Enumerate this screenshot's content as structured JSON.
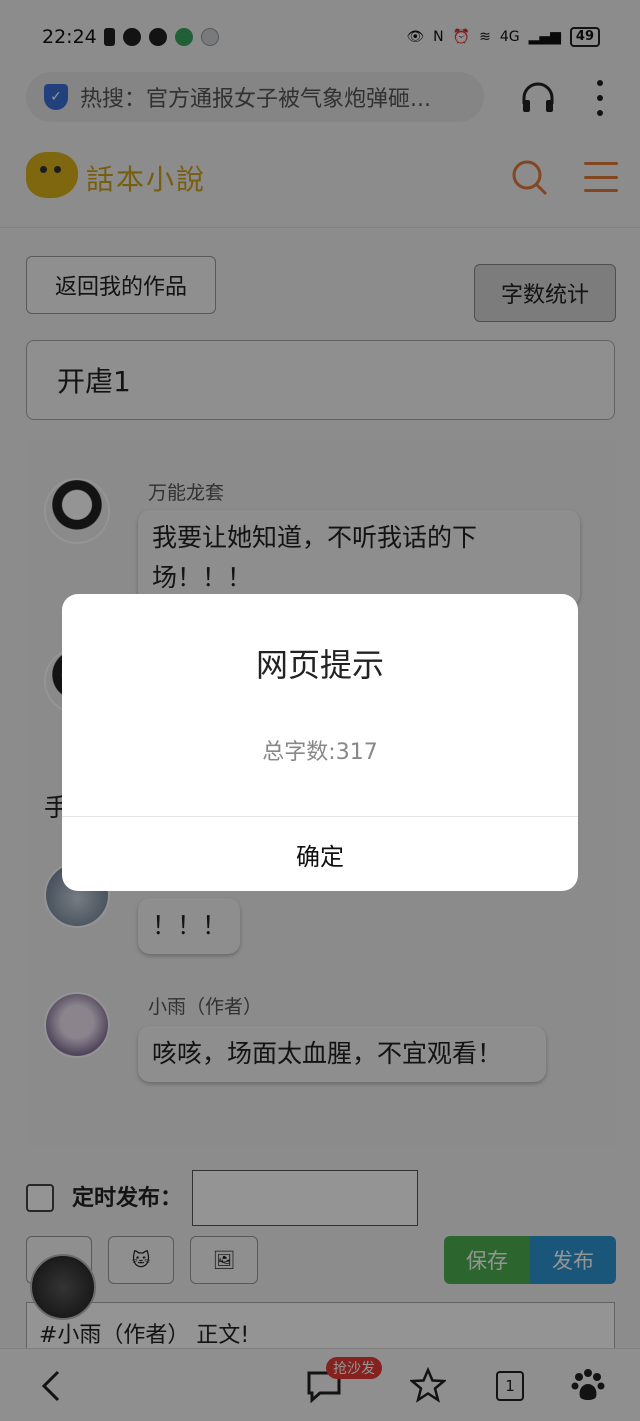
{
  "status_bar": {
    "time": "22:24",
    "network": "4G",
    "battery": "49"
  },
  "browser": {
    "search_text": "热搜：官方通报女子被气象炮弹砸..."
  },
  "site": {
    "logo_text": "話本小說"
  },
  "editor_page": {
    "back_button": "返回我的作品",
    "count_button": "字数统计",
    "title_value": "开虐1",
    "messages": [
      {
        "speaker": "万能龙套",
        "text": "我要让她知道，不听我话的下场！！！"
      },
      {
        "speaker": "",
        "text": ""
      },
      {
        "speaker": "",
        "text": "！！！"
      },
      {
        "speaker": "小雨（作者）",
        "text": "咳咳，场面太血腥，不宜观看！"
      }
    ],
    "side_text": "手",
    "schedule_label": "定时发布：",
    "save_button": "保存",
    "publish_button": "发布",
    "editor_text": "#小雨（作者） 正文!"
  },
  "bottom_nav": {
    "sofa_badge": "抢沙发",
    "tabs_count": "1"
  },
  "dialog": {
    "title": "网页提示",
    "message": "总字数:317",
    "ok_button": "确定"
  }
}
